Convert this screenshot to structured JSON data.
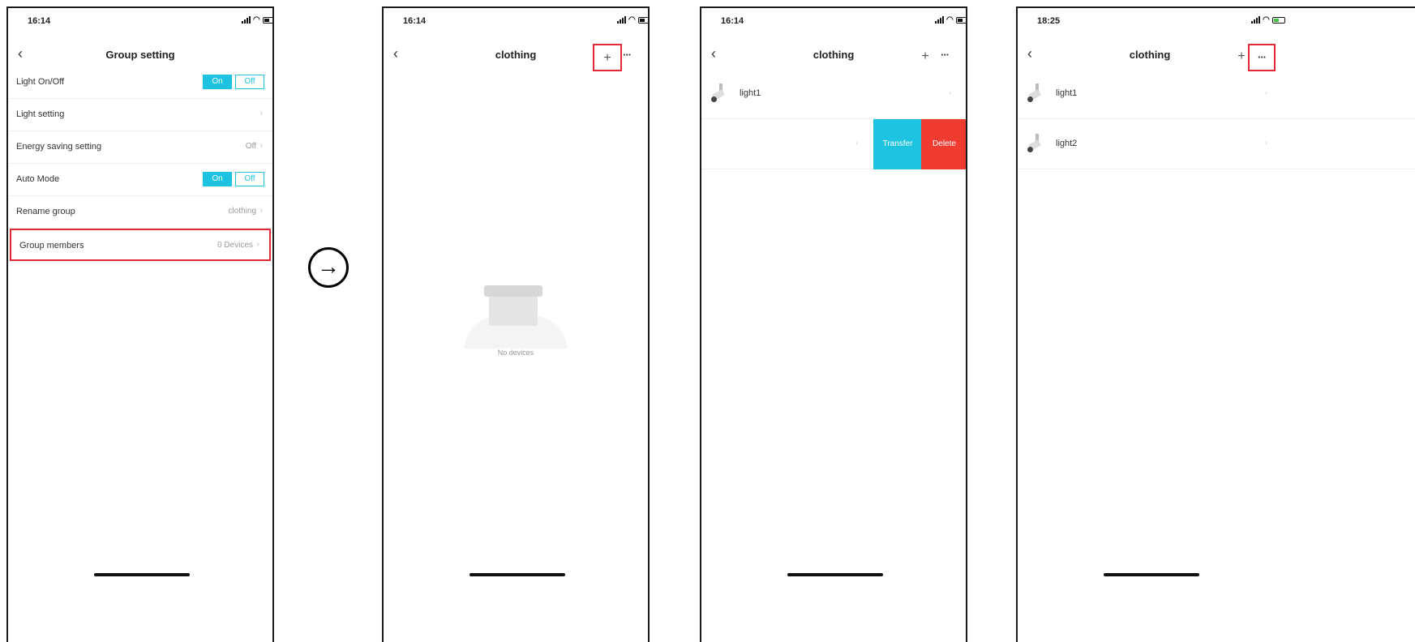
{
  "screen1": {
    "time": "16:14",
    "title": "Group setting",
    "back_icon": "chevron-left-icon",
    "rows": [
      {
        "label": "Light On/Off",
        "on": "On",
        "off": "Off"
      },
      {
        "label": "Light setting"
      },
      {
        "label": "Energy saving setting",
        "value": "Off"
      },
      {
        "label": "Auto Mode",
        "on": "On",
        "off": "Off"
      },
      {
        "label": "Rename group",
        "value": "clothing"
      },
      {
        "label": "Group members",
        "value": "0 Devices"
      }
    ]
  },
  "arrow_icon": "arrow-right-circle-icon",
  "arrow_glyph": "→",
  "screen2": {
    "time": "16:14",
    "title": "clothing",
    "plus": "+",
    "more": "···",
    "empty_text": "No devices"
  },
  "screen3": {
    "time": "16:14",
    "title": "clothing",
    "plus": "+",
    "more": "···",
    "devices": [
      "light1"
    ],
    "transfer": "Transfer",
    "delete": "Delete"
  },
  "screen4": {
    "time": "18:25",
    "title": "clothing",
    "plus": "+",
    "more": "···",
    "devices": [
      "light1",
      "light2"
    ]
  },
  "colors": {
    "accent": "#1fc3e2",
    "delete": "#f03c30",
    "highlight": "#e32836"
  }
}
